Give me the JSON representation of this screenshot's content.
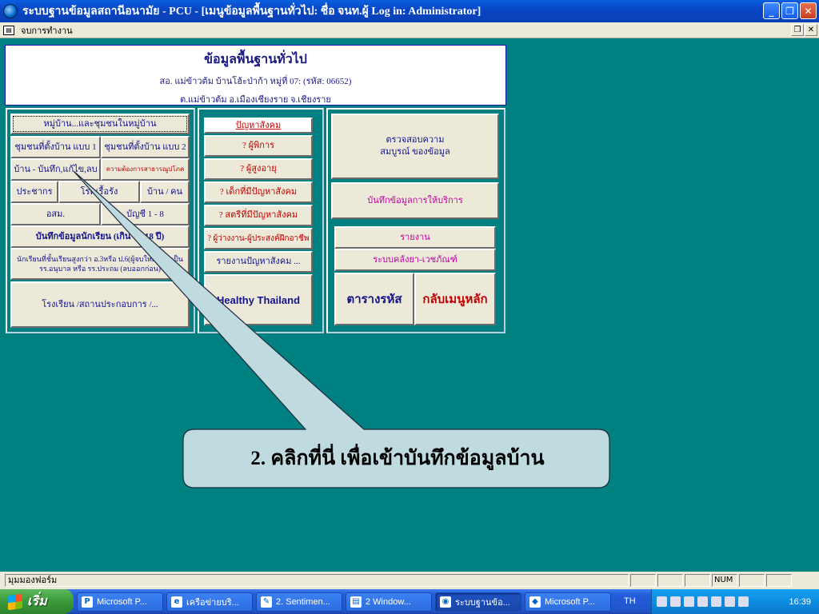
{
  "window": {
    "title": "ระบบฐานข้อมูลสถานีอนามัย - PCU - [เมนูข้อมูลพื้นฐานทั่วไป: ชื่อ จนท.ผู้ Log in: Administrator]",
    "btn_min": "_",
    "btn_max": "❐",
    "btn_close": "✕"
  },
  "menubar": {
    "item": "จบการทำงาน",
    "mdi_restore": "❐",
    "mdi_close": "✕"
  },
  "header": {
    "title": "ข้อมูลพื้นฐานทั่วไป",
    "line2": "สอ. แม่ข้าวต้ม บ้านโฮ้ะป่าก้า หมู่ที่ 07: (รหัส: 06652)",
    "line3": "ต.แม่ข้าวต้ม อ.เมืองเชียงราย จ.เชียงราย"
  },
  "left_panel": {
    "village_button": "หมู่บ้าน...และชุมชนในหมู่บ้าน",
    "community1": "ชุมชนที่ตั้งบ้าน แบบ 1",
    "community2": "ชุมชนที่ตั้งบ้าน แบบ 2",
    "house_record": "บ้าน - บันทึก,แก้ไข,ลบ",
    "public_health_need": "ความต้องการสาธารณูปโภค",
    "population": "ประชากร",
    "chronic_disease": "โรคเรื้อรัง",
    "house_per_person": "บ้าน / คน",
    "osm": "อสม.",
    "account": "บัญชี 1 - 8",
    "student_record": "บันทึกข้อมูลนักเรียน (เกิน 6 - 18 ปี)",
    "student_note": "นักเรียนที่ชั้นเรียนสูงกว่า อ.3หรือ ป.6(ผู้จบใหม่ เริ่ม เป็น รร.อนุบาล หรือ รร.ประถม (ลบออกก่อน)",
    "school": "โรงเรียน /สถานประกอบการ /..."
  },
  "middle_panel": {
    "social_problems": "ปัญหาสังคม",
    "disabled": "? ผู้พิการ",
    "elderly": "? ผู้สูงอายุ",
    "children": "? เด็กที่มีปัญหาสังคม",
    "women": "? สตรีที่มีปัญหาสังคม",
    "unemployed": "? ผู้ว่างงาน-ผู้ประสงค์ฝึกอาชีพ",
    "report": "รายงานปัญหาสังคม ...",
    "healthy_thailand": "Healthy Thailand"
  },
  "right_panel": {
    "check_completeness": "ตรวจสอบความสมบูรณ์ ของข้อมูล",
    "service_record": "บันทึกข้อมูลการให้บริการ",
    "report": "รายงาน",
    "drug_supply": "ระบบคลังยา-เวชภัณฑ์",
    "code_table": "ตารางรหัส",
    "main_menu": "กลับเมนูหลัก"
  },
  "callout": {
    "text": "2. คลิกที่นี่ เพื่อเข้าบันทึกข้อมูลบ้าน"
  },
  "statusbar": {
    "text": "มุมมองฟอร์ม",
    "num": "NUM"
  },
  "taskbar": {
    "start": "เริ่ม",
    "tasks": [
      {
        "label": "Microsoft P...",
        "icon": "P"
      },
      {
        "label": "เครือข่ายบริ...",
        "icon": "e"
      },
      {
        "label": "2. Sentimen...",
        "icon": "✎"
      },
      {
        "label": "2 Window...",
        "icon": "▤"
      },
      {
        "label": "ระบบฐานข้อ...",
        "icon": "◉"
      },
      {
        "label": "Microsoft P...",
        "icon": "◆"
      }
    ],
    "lang": "TH",
    "clock": "16:39"
  }
}
